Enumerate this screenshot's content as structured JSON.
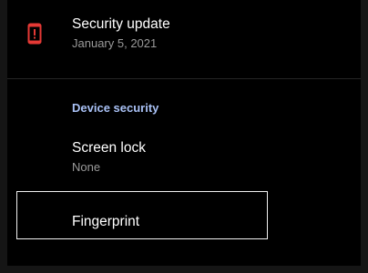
{
  "security_update": {
    "title": "Security update",
    "date": "January 5, 2021",
    "icon": "phone-alert-icon",
    "icon_color": "#e53935"
  },
  "device_security": {
    "header": "Device security",
    "header_color": "#a9c1f5",
    "screen_lock": {
      "title": "Screen lock",
      "value": "None"
    },
    "fingerprint": {
      "title": "Fingerprint"
    }
  }
}
